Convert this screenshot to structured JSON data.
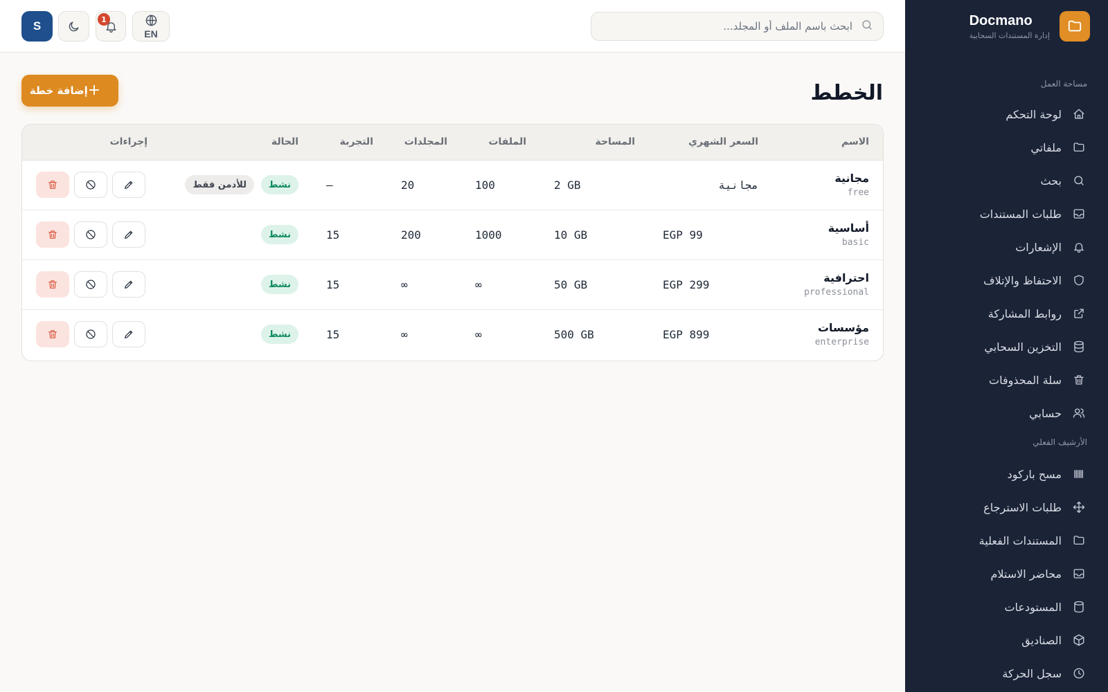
{
  "brand": {
    "name": "Docmano",
    "subtitle": "إدارة المستندات السحابية"
  },
  "sidebar": {
    "section_workspace": "مساحة العمل",
    "workspace_items": [
      {
        "label": "لوحة التحكم",
        "icon": "home-icon"
      },
      {
        "label": "ملفاتي",
        "icon": "folder-icon"
      },
      {
        "label": "بحث",
        "icon": "search-icon"
      },
      {
        "label": "طلبات المستندات",
        "icon": "inbox-icon"
      },
      {
        "label": "الإشعارات",
        "icon": "bell-icon"
      },
      {
        "label": "الاحتفاظ والإتلاف",
        "icon": "shield-icon"
      },
      {
        "label": "روابط المشاركة",
        "icon": "external-link-icon"
      },
      {
        "label": "التخزين السحابي",
        "icon": "database-icon"
      },
      {
        "label": "سلة المحذوفات",
        "icon": "trash-icon"
      },
      {
        "label": "حسابي",
        "icon": "users-icon"
      }
    ],
    "section_archive": "الأرشيف الفعلي",
    "archive_items": [
      {
        "label": "مسح باركود",
        "icon": "barcode-icon"
      },
      {
        "label": "طلبات الاسترجاع",
        "icon": "move-icon"
      },
      {
        "label": "المستندات الفعلية",
        "icon": "folder-icon"
      },
      {
        "label": "محاضر الاستلام",
        "icon": "inbox-icon"
      },
      {
        "label": "المستودعات",
        "icon": "database-icon"
      },
      {
        "label": "الصناديق",
        "icon": "box-icon"
      },
      {
        "label": "سجل الحركة",
        "icon": "clock-icon"
      }
    ]
  },
  "topbar": {
    "search_placeholder": "ابحث باسم الملف أو المجلد...",
    "language_label": "EN",
    "notification_count": "1",
    "avatar_initial": "S"
  },
  "page": {
    "title": "الخطط",
    "add_button_label": "إضافة خطة"
  },
  "table": {
    "columns": [
      "الاسم",
      "السعر الشهري",
      "المساحة",
      "الملفات",
      "المجلدات",
      "التجربة",
      "الحالة",
      "إجراءات"
    ],
    "rows": [
      {
        "name": "مجانية",
        "code": "free",
        "price": "مجانية",
        "storage": "2 GB",
        "files": "100",
        "folders": "20",
        "trial": "—",
        "status": "نشط",
        "extra_badge": "للأدمن فقط"
      },
      {
        "name": "أساسية",
        "code": "basic",
        "price": "EGP 99",
        "storage": "10 GB",
        "files": "1000",
        "folders": "200",
        "trial": "15",
        "status": "نشط",
        "extra_badge": ""
      },
      {
        "name": "احترافية",
        "code": "professional",
        "price": "EGP 299",
        "storage": "50 GB",
        "files": "∞",
        "folders": "∞",
        "trial": "15",
        "status": "نشط",
        "extra_badge": ""
      },
      {
        "name": "مؤسسات",
        "code": "enterprise",
        "price": "EGP 899",
        "storage": "500 GB",
        "files": "∞",
        "folders": "∞",
        "trial": "15",
        "status": "نشط",
        "extra_badge": ""
      }
    ]
  },
  "colors": {
    "sidebar_bg": "#1b2337",
    "accent": "#dd8a21",
    "active_badge": "#0f8a5f",
    "delete": "#d9573f",
    "avatar_bg": "#1f4f8c"
  }
}
